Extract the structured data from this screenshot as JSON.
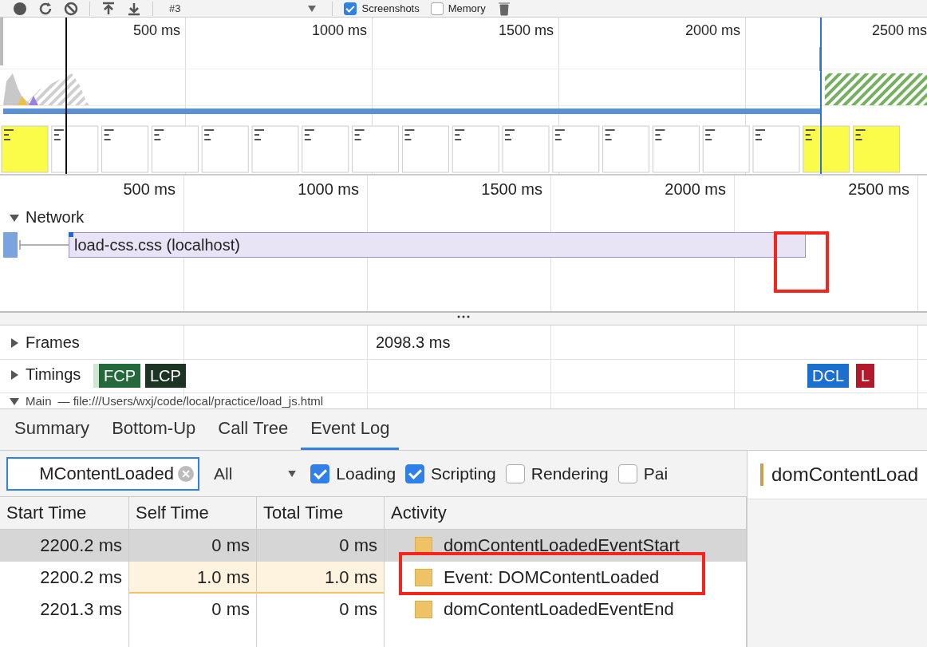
{
  "toolbar": {
    "profile": "#3",
    "options": [
      {
        "label": "Screenshots",
        "checked": true
      },
      {
        "label": "Memory",
        "checked": false
      }
    ]
  },
  "overview": {
    "ticks": [
      "500 ms",
      "1000 ms",
      "1500 ms",
      "2000 ms",
      "2500 ms"
    ]
  },
  "ruler": {
    "ticks": [
      "500 ms",
      "1000 ms",
      "1500 ms",
      "2000 ms",
      "2500 ms"
    ]
  },
  "network": {
    "label": "Network",
    "expanded": true,
    "requests": [
      {
        "label": "load-css.css (localhost)"
      }
    ]
  },
  "frames": {
    "label": "Frames",
    "expanded": false,
    "duration": "2098.3 ms"
  },
  "timings": {
    "label": "Timings",
    "expanded": false,
    "markers": [
      {
        "color": "#cfe6d3"
      },
      {
        "label": "FCP",
        "color": "#24693a"
      },
      {
        "label": "LCP",
        "color": "#1b3423"
      },
      {
        "label": "DCL",
        "color": "#1b6fce"
      },
      {
        "label": "L",
        "color": "#b3182b"
      }
    ]
  },
  "main": {
    "label": "Main",
    "detail": "— file:///Users/wxj/code/local/practice/load_js.html",
    "expanded": true
  },
  "tabs": [
    {
      "label": "Summary",
      "selected": false
    },
    {
      "label": "Bottom-Up",
      "selected": false
    },
    {
      "label": "Call Tree",
      "selected": false
    },
    {
      "label": "Event Log",
      "selected": true
    }
  ],
  "filter": {
    "value": "MContentLoaded",
    "category": "All",
    "categories": [
      {
        "label": "Loading",
        "checked": true
      },
      {
        "label": "Scripting",
        "checked": true
      },
      {
        "label": "Rendering",
        "checked": false
      },
      {
        "label": "Pai",
        "checked": false
      }
    ]
  },
  "table": {
    "columns": [
      "Start Time",
      "Self Time",
      "Total Time",
      "Activity"
    ],
    "rows": [
      {
        "start": "2200.2 ms",
        "self": "0 ms",
        "total": "0 ms",
        "activity": "domContentLoadedEventStart",
        "selected": true,
        "highlighted": false
      },
      {
        "start": "2200.2 ms",
        "self": "1.0 ms",
        "total": "1.0 ms",
        "activity": "Event: DOMContentLoaded",
        "selected": false,
        "highlighted": true
      },
      {
        "start": "2201.3 ms",
        "self": "0 ms",
        "total": "0 ms",
        "activity": "domContentLoadedEventEnd",
        "selected": false,
        "highlighted": false
      }
    ]
  },
  "details": {
    "title": "domContentLoad"
  }
}
